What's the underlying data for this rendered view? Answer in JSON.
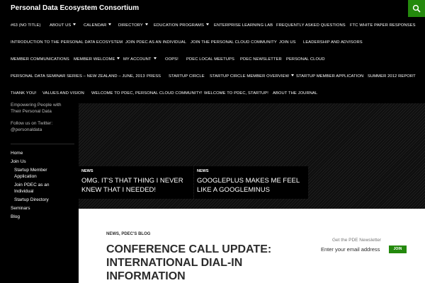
{
  "site": {
    "title": "Personal Data Ecosystem Consortium"
  },
  "nav": {
    "rows": [
      [
        {
          "label": "#63 (no title)",
          "dropdown": false
        },
        {
          "label": "About Us",
          "dropdown": true
        },
        {
          "label": "Calendar",
          "dropdown": true
        },
        {
          "label": "Directory",
          "dropdown": true
        },
        {
          "label": "Education Programs",
          "dropdown": true
        },
        {
          "label": "Enterprise Learning Lab",
          "dropdown": false
        },
        {
          "label": "Frequently Asked Questions",
          "dropdown": false
        },
        {
          "label": "FTC White Paper Responses",
          "dropdown": false
        }
      ],
      [
        {
          "label": "Introduction to the Personal Data Ecosystem",
          "dropdown": false
        },
        {
          "label": "Join PDEC as an Individual",
          "dropdown": false
        },
        {
          "label": "Join the Personal Cloud Community",
          "dropdown": false
        },
        {
          "label": "Join Us",
          "dropdown": false
        },
        {
          "label": "Leadership and Advisors",
          "dropdown": false
        }
      ],
      [
        {
          "label": "Member Communications",
          "dropdown": false
        },
        {
          "label": "Member Welcome",
          "dropdown": true
        },
        {
          "label": "My Account",
          "dropdown": true
        },
        {
          "label": "Oops!",
          "dropdown": false
        },
        {
          "label": "PDEC Local Meetups",
          "dropdown": false
        },
        {
          "label": "PDEC Newsletter",
          "dropdown": false
        },
        {
          "label": "Personal Cloud",
          "dropdown": false
        }
      ],
      [
        {
          "label": "Personal Data Seminar Series – New Zealand – June, 2013",
          "dropdown": false
        },
        {
          "label": "Press",
          "dropdown": false
        },
        {
          "label": "Startup Circle",
          "dropdown": false
        },
        {
          "label": "Startup Circle Member Overview",
          "dropdown": true
        },
        {
          "label": "Startup Member Application",
          "dropdown": false
        },
        {
          "label": "Summer 2012 Report",
          "dropdown": false
        }
      ],
      [
        {
          "label": "Thank You!",
          "dropdown": false
        },
        {
          "label": "Values and Vision",
          "dropdown": false
        },
        {
          "label": "Welcome to PDEC, Personal Cloud Community!",
          "dropdown": false
        },
        {
          "label": "Welcome to PDEC, Startup!",
          "dropdown": false
        },
        {
          "label": "About the Journal",
          "dropdown": false
        }
      ]
    ]
  },
  "sidebar": {
    "tagline": [
      "Empowering People with",
      "Their Personal Data"
    ],
    "twitter": [
      "Follow us on Twitter:",
      "@personaldata"
    ],
    "menu": {
      "home": "Home",
      "join_us": "Join Us",
      "startup_app": [
        "Startup Member",
        "Application"
      ],
      "join_individual": [
        "Join PDEC as an",
        "Individual"
      ],
      "startup_directory": "Startup Directory",
      "seminars": "Seminars",
      "blog": "Blog"
    }
  },
  "featured": [
    {
      "category": "News",
      "title": [
        "OMG. It's that thing I never",
        "knew that I needed!"
      ]
    },
    {
      "category": "News",
      "title": [
        "GooglePlus makes me feel",
        "like a GoogleMinus"
      ]
    }
  ],
  "entry": {
    "categories": "News, PDEC's Blog",
    "title": [
      "Conference Call Update:",
      "International Dial-In",
      "Information"
    ]
  },
  "newsletter": {
    "label": "Get the PDE Newsletter",
    "placeholder": "Enter your email address",
    "button": "Join"
  },
  "icons": {
    "search": "search-icon"
  },
  "colors": {
    "accent": "#24890d",
    "background": "#000000",
    "content": "#ffffff"
  }
}
